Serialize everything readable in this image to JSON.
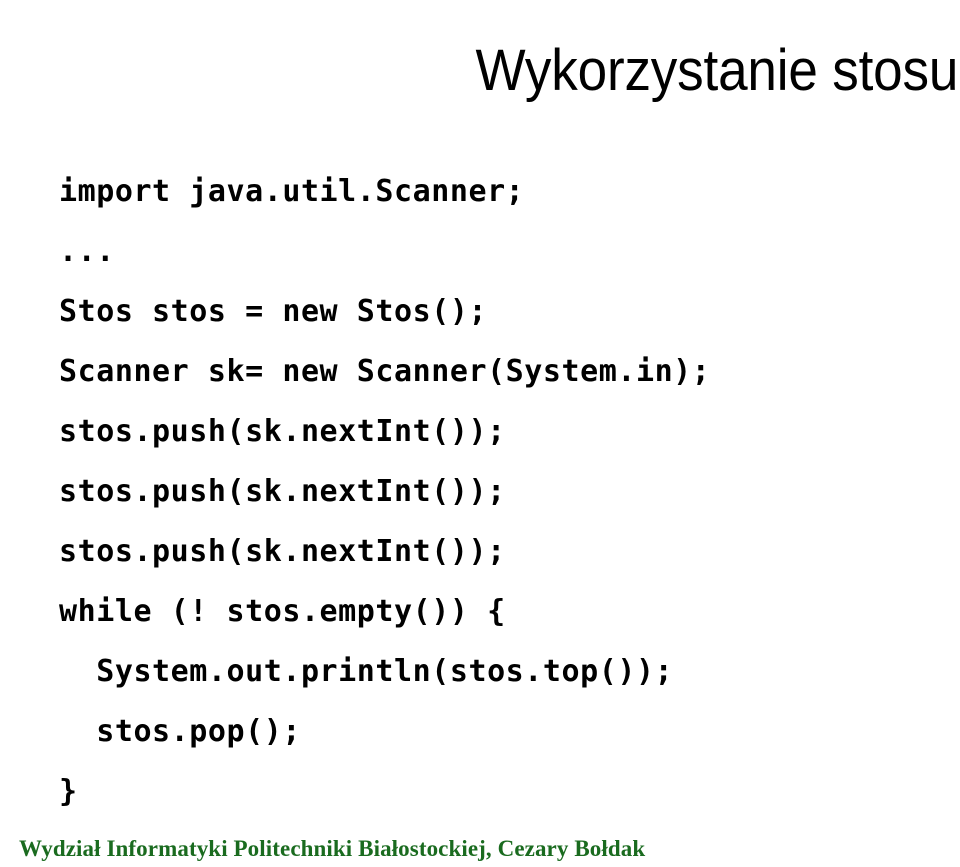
{
  "slide": {
    "title": "Wykorzystanie stosu",
    "title_color": "#000000",
    "background_color": "#ffffff"
  },
  "code": {
    "language": "java",
    "text_color": "#000000",
    "lines": [
      "import java.util.Scanner;",
      "...",
      "Stos stos = new Stos();",
      "Scanner sk= new Scanner(System.in);",
      "stos.push(sk.nextInt());",
      "stos.push(sk.nextInt());",
      "stos.push(sk.nextInt());",
      "while (! stos.empty()) {",
      "  System.out.println(stos.top());",
      "  stos.pop();",
      "}"
    ]
  },
  "footer": {
    "text": "Wydział Informatyki Politechniki Białostockiej, Cezary Bołdak",
    "color": "#1a6b1f"
  }
}
